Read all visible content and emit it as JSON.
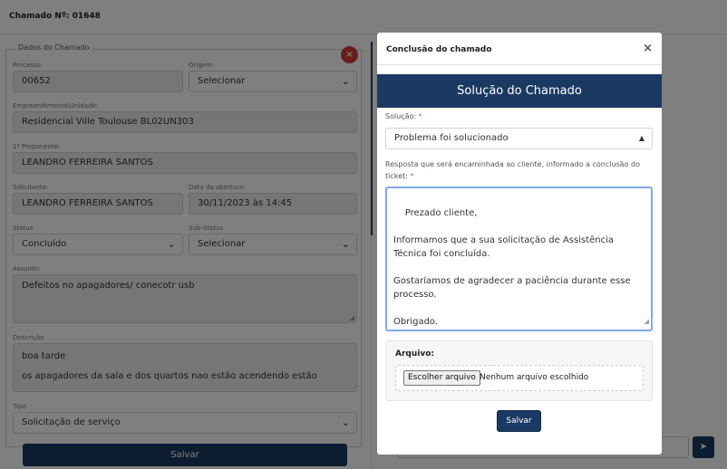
{
  "page": {
    "title": "Chamado Nº: 01648"
  },
  "form": {
    "legend": "Dados do Chamado",
    "processo": {
      "label": "Processo:",
      "value": "00652"
    },
    "origem": {
      "label": "Origem:",
      "value": "Selecionar"
    },
    "empreendimento": {
      "label": "Empreendimento\\Unidade:",
      "value": "Residencial Ville Toulouse BL02UN303"
    },
    "proponente": {
      "label": "1º Proponente:",
      "value": "LEANDRO FERREIRA SANTOS"
    },
    "solicitante": {
      "label": "Solicitante:",
      "value": "LEANDRO FERREIRA SANTOS"
    },
    "data_abertura": {
      "label": "Data da abertura:",
      "value": "30/11/2023 às 14:45"
    },
    "status": {
      "label": "Status",
      "value": "Concluído"
    },
    "substatus": {
      "label": "Sub-Status",
      "value": "Selecionar"
    },
    "assunto": {
      "label": "Assunto:",
      "value": "Defeitos no apagadores/ conecotr usb"
    },
    "descricao": {
      "label": "Descrição",
      "line1": "boa tarde",
      "line2": "os apagadores da sala e dos quartos nao estão acendendo estão"
    },
    "tipo": {
      "label": "Tipo",
      "value": "Solicitação de serviço"
    },
    "save_label": "Salvar"
  },
  "modal": {
    "title": "Conclusão do chamado",
    "close": "×",
    "banner": "Solução do Chamado",
    "solucao_label": "Solução:",
    "required_mark": "*",
    "solucao_value": "Problema foi solucionado",
    "resposta_label": "Resposta que será encaminhada ao cliente, informado a conclusão do ticket:",
    "resposta_text": "Prezado cliente,\n\nInformamos que a sua solicitação de Assistência Técnica foi concluída.\n\nGostaríamos de agradecer a paciência durante esse processo.\n\nObrigado.",
    "arquivo_label": "Arquivo:",
    "file_button": "Escolher arquivo",
    "file_none": "Nenhum arquivo escolhido",
    "save_label": "Salvar"
  },
  "icons": {
    "close_red": "×",
    "chevron": "⌄",
    "send": "➤",
    "grip": "◢"
  },
  "colors": {
    "brand": "#1b3a63",
    "danger": "#d23b3b"
  }
}
